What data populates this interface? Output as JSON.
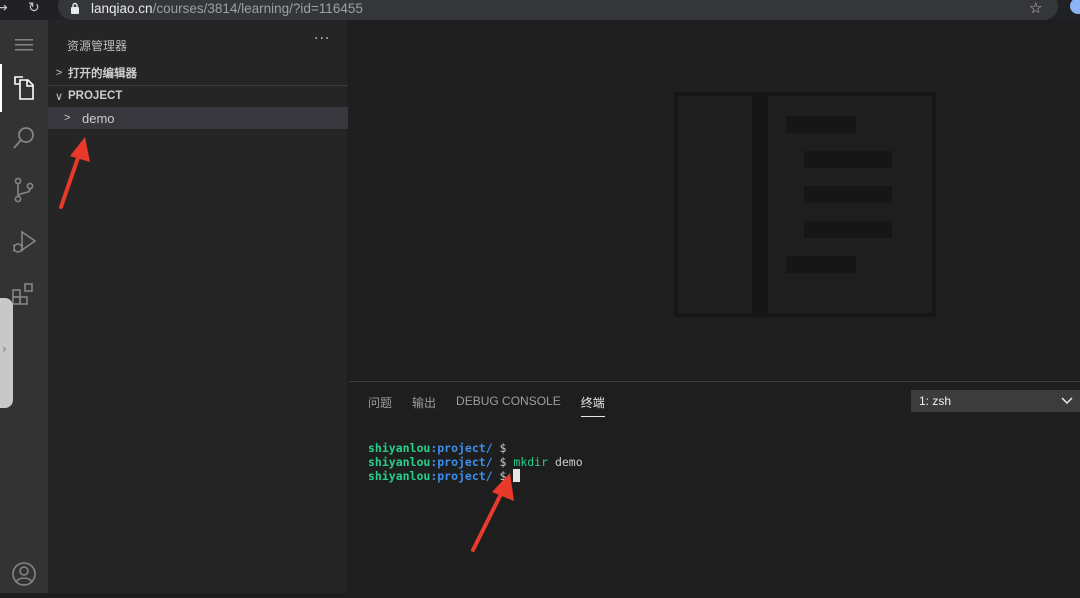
{
  "browser": {
    "domain": "lanqiao.cn",
    "path": "/courses/3814/learning/?id=116455"
  },
  "sidebar": {
    "title": "资源管理器",
    "more": "···",
    "sections": [
      {
        "label": "打开的编辑器",
        "chevron": ">"
      },
      {
        "label": "PROJECT",
        "chevron": "∨"
      }
    ],
    "tree": [
      {
        "label": "demo",
        "chevron": ">"
      }
    ]
  },
  "panel": {
    "tabs": [
      {
        "label": "问题",
        "active": false
      },
      {
        "label": "输出",
        "active": false
      },
      {
        "label": "DEBUG CONSOLE",
        "active": false
      },
      {
        "label": "终端",
        "active": true
      }
    ],
    "terminal_select": "1: zsh",
    "terminal_lines": [
      {
        "user": "shiyanlou",
        "path": ":project/",
        "prompt": " $ ",
        "cmd": "",
        "arg": ""
      },
      {
        "user": "shiyanlou",
        "path": ":project/",
        "prompt": " $ ",
        "cmd": "mkdir",
        "arg": " demo"
      },
      {
        "user": "shiyanlou",
        "path": ":project/",
        "prompt": " $ ",
        "cmd": "",
        "arg": ""
      }
    ]
  },
  "colors": {
    "accent_arrow": "#e8392b",
    "terminal_green": "#23d18b",
    "terminal_blue": "#3b8eea"
  },
  "icons": [
    "menu-icon",
    "files-icon",
    "search-icon",
    "source-control-icon",
    "run-debug-icon",
    "extensions-icon",
    "account-icon"
  ]
}
